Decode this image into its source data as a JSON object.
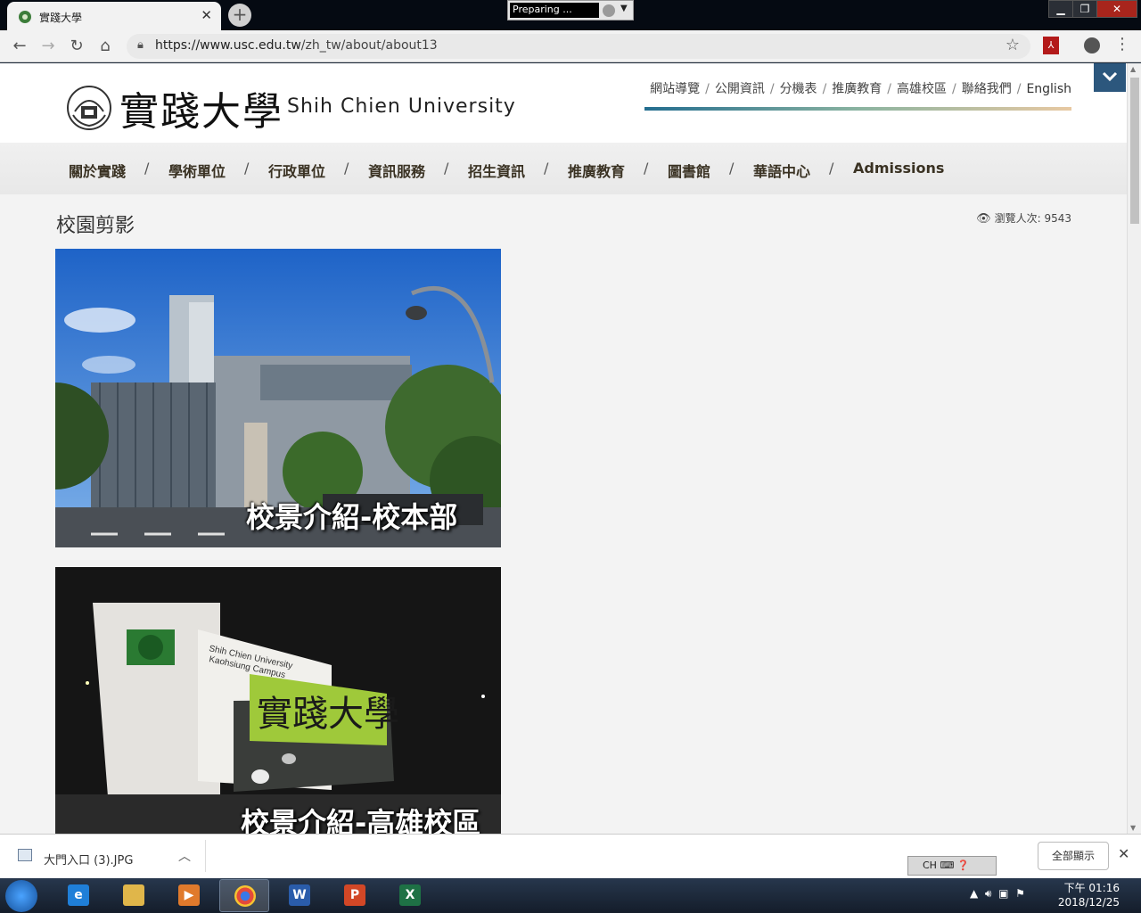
{
  "browser": {
    "tab_title": "實踐大學",
    "tab_close": "✕",
    "new_tab": "+",
    "status_widget": "Preparing ...",
    "url_host": "https://www.usc.edu.tw",
    "url_path": "/zh_tw/about/about13"
  },
  "site": {
    "logo_zh": "實踐大學",
    "logo_en": "Shih Chien University",
    "top_links": [
      "網站導覽",
      "公開資訊",
      "分機表",
      "推廣教育",
      "高雄校區",
      "聯絡我們",
      "English"
    ],
    "main_nav": [
      "關於實踐",
      "學術單位",
      "行政單位",
      "資訊服務",
      "招生資訊",
      "推廣教育",
      "圖書館",
      "華語中心",
      "Admissions"
    ],
    "page_title": "校園剪影",
    "view_label": "瀏覽人次:",
    "view_count": "9543",
    "photos": [
      {
        "caption": "校景介紹-校本部"
      },
      {
        "caption": "校景介紹-高雄校區"
      }
    ],
    "sign_en_line1": "Shih Chien University",
    "sign_en_line2": "Kaohsiung Campus"
  },
  "download_shelf": {
    "file_name": "大門入口 (3).JPG",
    "show_all": "全部顯示",
    "ime": "CH"
  },
  "taskbar": {
    "time": "下午 01:16",
    "date": "2018/12/25"
  }
}
